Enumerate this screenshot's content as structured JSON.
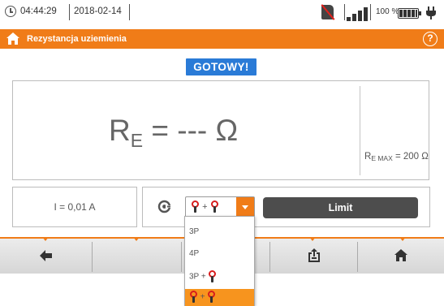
{
  "statusbar": {
    "time": "04:44:29",
    "date": "2018-02-14",
    "battery_percent": "100 %",
    "icons": [
      "clock-icon",
      "no-memory-card-icon",
      "signal-strength-icon",
      "battery-icon",
      "power-plug-icon"
    ]
  },
  "titlebar": {
    "title": "Rezystancja uziemienia",
    "help_label": "?"
  },
  "status": {
    "ready_label": "GOTOWY!"
  },
  "result": {
    "symbol": "R",
    "subscript": "E",
    "value_text": " = --- Ω",
    "limit_symbol": "R",
    "limit_subscript": "E MAX",
    "limit_text": " = 200 Ω"
  },
  "current": {
    "label": "I = 0,01 A"
  },
  "method": {
    "selected_value": "+",
    "limit_button_label": "Limit",
    "options": [
      {
        "label": "3P",
        "selected": false
      },
      {
        "label": "4P",
        "selected": false
      },
      {
        "label": "3P +",
        "selected": false
      },
      {
        "label": "+",
        "selected": true
      }
    ]
  },
  "bottombar": {
    "buttons": [
      {
        "name": "back",
        "icon": "arrow-left-icon"
      },
      {
        "name": "empty-1",
        "icon": ""
      },
      {
        "name": "empty-2",
        "icon": ""
      },
      {
        "name": "save",
        "icon": "save-memory-icon"
      },
      {
        "name": "home",
        "icon": "home-icon"
      }
    ]
  },
  "colors": {
    "accent": "#f07c18",
    "ready_badge": "#2a7bd7",
    "limit_button": "#4d4d4d",
    "clamp_red": "#d81d1d"
  }
}
